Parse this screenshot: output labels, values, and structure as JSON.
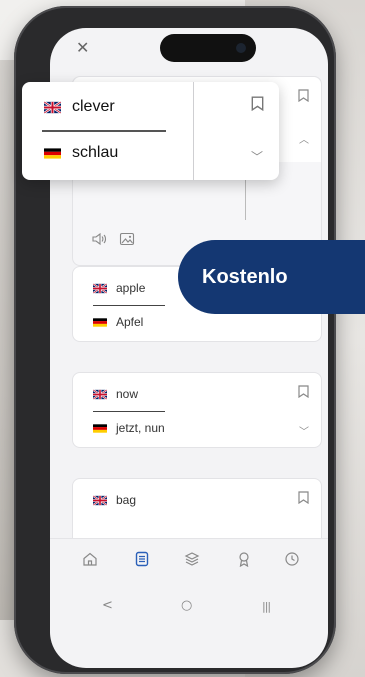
{
  "popup": {
    "english": "clever",
    "german": "schlau",
    "flags": [
      "uk-flag",
      "germany-flag"
    ]
  },
  "cards": [
    {
      "english": "apple",
      "german": "Apfel"
    },
    {
      "english": "now",
      "german": "jetzt, nun"
    },
    {
      "english": "bag"
    }
  ],
  "banner": {
    "text": "Kostenlo"
  },
  "tabbar": {
    "items": [
      "home-icon",
      "list-icon",
      "layers-icon",
      "award-icon",
      "clock-icon"
    ],
    "active": "list-icon"
  },
  "system_nav": {
    "back": "<",
    "home": "○",
    "recents": "|||"
  },
  "colors": {
    "banner": "#143772",
    "accent": "#2a5fb8"
  }
}
